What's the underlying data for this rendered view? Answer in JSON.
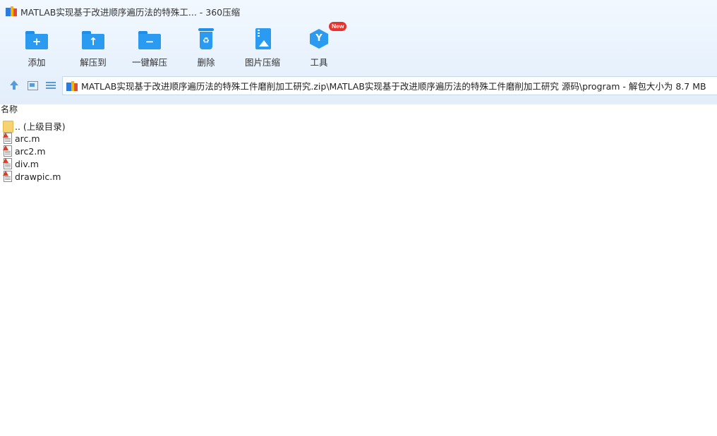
{
  "window": {
    "title": "MATLAB实现基于改进顺序遍历法的特殊工... - 360压缩"
  },
  "toolbar": {
    "items": [
      {
        "label": "添加",
        "icon": "add-folder-icon"
      },
      {
        "label": "解压到",
        "icon": "extract-to-folder-icon"
      },
      {
        "label": "一键解压",
        "icon": "one-click-extract-icon"
      },
      {
        "label": "删除",
        "icon": "trash-icon"
      },
      {
        "label": "图片压缩",
        "icon": "image-compress-icon"
      },
      {
        "label": "工具",
        "icon": "tools-cube-icon",
        "badge": "New"
      }
    ]
  },
  "address": {
    "path": "MATLAB实现基于改进顺序遍历法的特殊工件磨削加工研究.zip\\MATLAB实现基于改进顺序遍历法的特殊工件磨削加工研究 源码\\program - 解包大小为 8.7 MB"
  },
  "list": {
    "column_header": "名称",
    "items": [
      {
        "name": ".. (上级目录)",
        "type": "parent-folder"
      },
      {
        "name": "arc.m",
        "type": "matlab-file"
      },
      {
        "name": "arc2.m",
        "type": "matlab-file"
      },
      {
        "name": "div.m",
        "type": "matlab-file"
      },
      {
        "name": "drawpic.m",
        "type": "matlab-file"
      }
    ]
  },
  "colors": {
    "accent": "#2a9bf0",
    "badge": "#e8332c",
    "chrome_bg": "#e8f2fd"
  }
}
